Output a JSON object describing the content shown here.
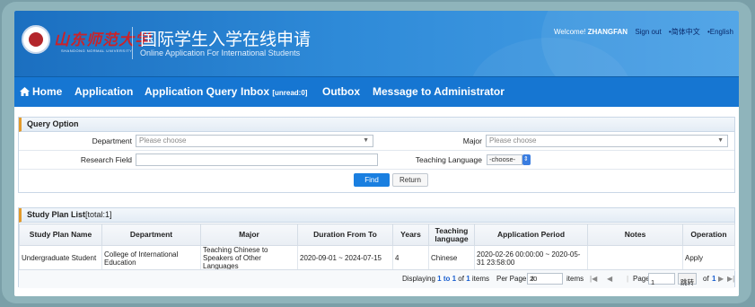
{
  "header": {
    "university_name": "山东师范大学",
    "university_name_en": "SHANDONG NORMAL UNIVERSITY",
    "system_title_cn": "国际学生入学在线申请",
    "system_title_en": "Online Application For International Students",
    "welcome_prefix": "Welcome!",
    "username": "ZHANGFAN",
    "sign_out": "Sign out",
    "lang_cn": "•简体中文",
    "lang_en": "•English"
  },
  "nav": {
    "home": "Home",
    "application": "Application",
    "application_query": "Application Query",
    "inbox": "Inbox",
    "inbox_unread": "[unread:0]",
    "outbox": "Outbox",
    "message_admin": "Message to Administrator"
  },
  "query": {
    "title": "Query Option",
    "department_label": "Department",
    "department_placeholder": "Please choose",
    "major_label": "Major",
    "major_placeholder": "Please choose",
    "research_label": "Research Field",
    "research_value": "",
    "teaching_lang_label": "Teaching Language",
    "teaching_lang_value": "-choose-",
    "find": "Find",
    "return": "Return"
  },
  "plans": {
    "title": "Study Plan List",
    "total": "[total:1]",
    "columns": [
      "Study Plan Name",
      "Department",
      "Major",
      "Duration From To",
      "Years",
      "Teaching language",
      "Application Period",
      "Notes",
      "Operation"
    ],
    "rows": [
      {
        "name": "Undergraduate Student",
        "department": "College of International Education",
        "major": "Teaching Chinese to Speakers of Other Languages",
        "duration": "2020-09-01 ~ 2024-07-15",
        "years": "4",
        "language": "Chinese",
        "period": "2020-02-26 00:00:00 ~ 2020-05-31 23:58:00",
        "notes": "",
        "operation": "Apply"
      }
    ],
    "pager": {
      "displaying": "Displaying",
      "range": "1 to 1",
      "of": "of",
      "total_items": "1",
      "items": "items",
      "per_page_label": "Per Page",
      "per_page_value": "20",
      "items_label": "items",
      "page_label": "Page",
      "page_value": "1",
      "go_label": "跳转",
      "of_label": "of",
      "total_pages": "1"
    }
  },
  "colors": {
    "nav_bg": "#1676d2",
    "accent_orange": "#e39a2b",
    "link_blue": "#1a5fcf"
  }
}
